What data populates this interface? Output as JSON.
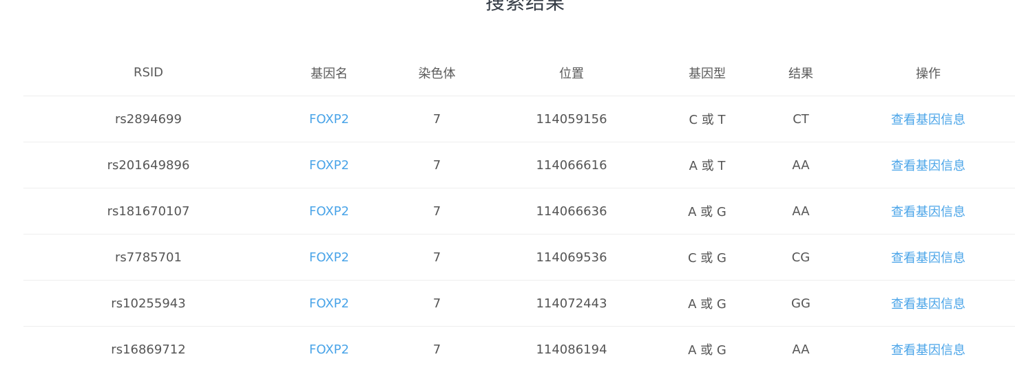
{
  "page": {
    "title": "搜索结果"
  },
  "table": {
    "headers": {
      "rsid": "RSID",
      "gene": "基因名",
      "chromosome": "染色体",
      "position": "位置",
      "genotype": "基因型",
      "result": "结果",
      "action": "操作"
    },
    "rows": [
      {
        "rsid": "rs2894699",
        "gene": "FOXP2",
        "chromosome": "7",
        "position": "114059156",
        "genotype": "C 或 T",
        "result": "CT",
        "action": "查看基因信息"
      },
      {
        "rsid": "rs201649896",
        "gene": "FOXP2",
        "chromosome": "7",
        "position": "114066616",
        "genotype": "A 或 T",
        "result": "AA",
        "action": "查看基因信息"
      },
      {
        "rsid": "rs181670107",
        "gene": "FOXP2",
        "chromosome": "7",
        "position": "114066636",
        "genotype": "A 或 G",
        "result": "AA",
        "action": "查看基因信息"
      },
      {
        "rsid": "rs7785701",
        "gene": "FOXP2",
        "chromosome": "7",
        "position": "114069536",
        "genotype": "C 或 G",
        "result": "CG",
        "action": "查看基因信息"
      },
      {
        "rsid": "rs10255943",
        "gene": "FOXP2",
        "chromosome": "7",
        "position": "114072443",
        "genotype": "A 或 G",
        "result": "GG",
        "action": "查看基因信息"
      },
      {
        "rsid": "rs16869712",
        "gene": "FOXP2",
        "chromosome": "7",
        "position": "114086194",
        "genotype": "A 或 G",
        "result": "AA",
        "action": "查看基因信息"
      }
    ]
  },
  "colors": {
    "link": "#4aa4e8",
    "text": "#555555",
    "divider": "#eeeeee"
  }
}
